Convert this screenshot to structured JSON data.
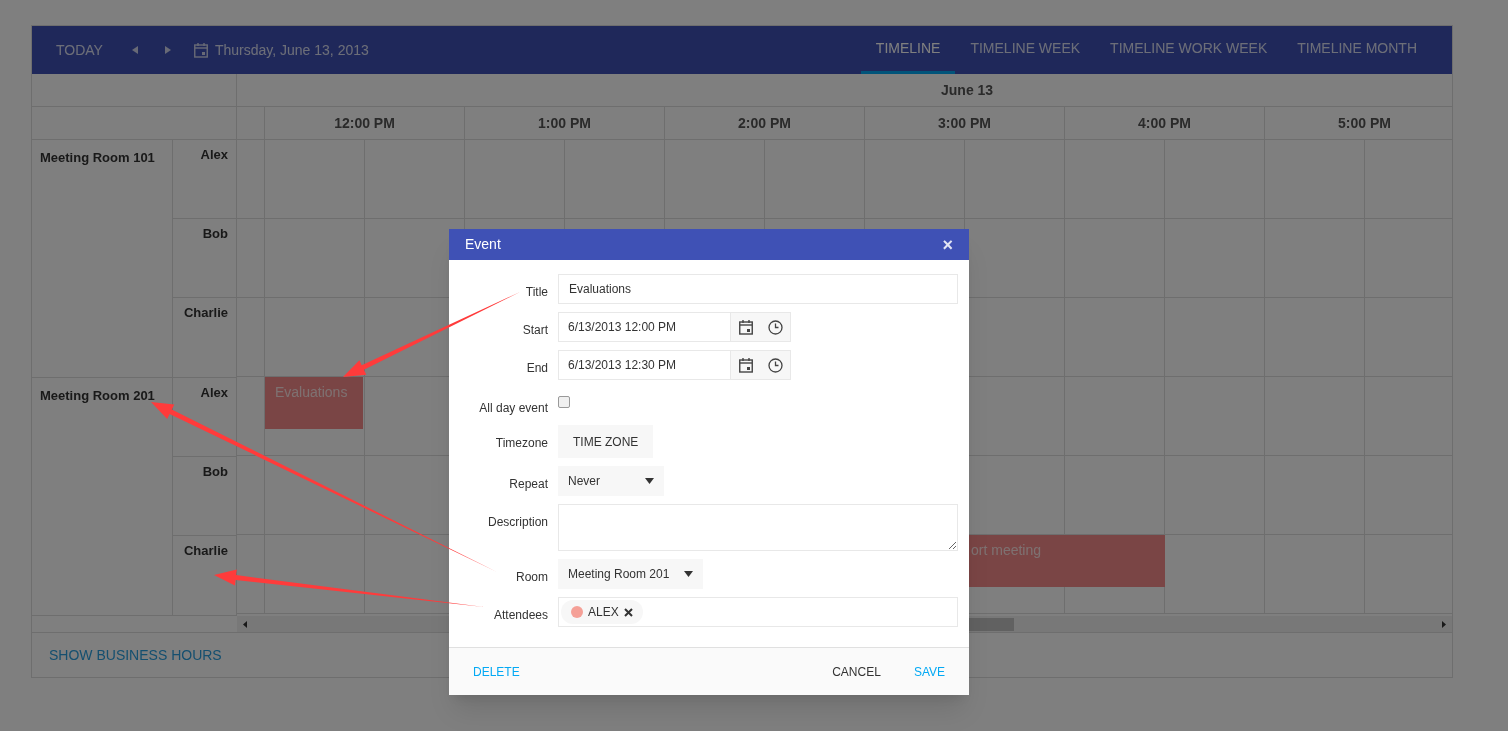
{
  "toolbar": {
    "today": "TODAY",
    "date": "Thursday, June 13, 2013"
  },
  "views": [
    {
      "label": "TIMELINE",
      "selected": true
    },
    {
      "label": "TIMELINE WEEK",
      "selected": false
    },
    {
      "label": "TIMELINE WORK WEEK",
      "selected": false
    },
    {
      "label": "TIMELINE MONTH",
      "selected": false
    }
  ],
  "date_header": "June 13",
  "time_slots": [
    "12:00 PM",
    "1:00 PM",
    "2:00 PM",
    "3:00 PM",
    "4:00 PM",
    "5:00 PM"
  ],
  "groups": [
    {
      "name": "Meeting Room 101",
      "resources": [
        {
          "name": "Alex"
        },
        {
          "name": "Bob"
        },
        {
          "name": "Charlie"
        }
      ]
    },
    {
      "name": "Meeting Room 201",
      "resources": [
        {
          "name": "Alex",
          "events": [
            {
              "title": "Evaluations"
            }
          ]
        },
        {
          "name": "Bob"
        },
        {
          "name": "Charlie",
          "events": [
            {
              "title": "ort meeting"
            }
          ]
        }
      ]
    }
  ],
  "footer_link": "SHOW BUSINESS HOURS",
  "dialog": {
    "title": "Event",
    "close": "×",
    "fields": [
      {
        "label": "Title",
        "kind": "text",
        "value": "Evaluations"
      },
      {
        "label": "Start",
        "kind": "datetime",
        "value": "6/13/2013 12:00 PM"
      },
      {
        "label": "End",
        "kind": "datetime",
        "value": "6/13/2013 12:30 PM"
      },
      {
        "label": "All day event",
        "kind": "checkbox",
        "checked": false
      },
      {
        "label": "Timezone",
        "kind": "button",
        "value": "TIME ZONE"
      },
      {
        "label": "Repeat",
        "kind": "dropdown",
        "value": "Never"
      },
      {
        "label": "Description",
        "kind": "textarea"
      },
      {
        "label": "Room",
        "kind": "dropdown",
        "value": "Meeting Room 201"
      },
      {
        "label": "Attendees",
        "kind": "tags",
        "tags": [
          {
            "label": "ALEX",
            "color": "#f5a097"
          }
        ]
      }
    ],
    "buttons_left": [
      {
        "label": "DELETE",
        "kind": "primary"
      }
    ],
    "buttons_right": [
      {
        "label": "CANCEL",
        "kind": "plain"
      },
      {
        "label": "SAVE",
        "kind": "primary"
      }
    ]
  }
}
